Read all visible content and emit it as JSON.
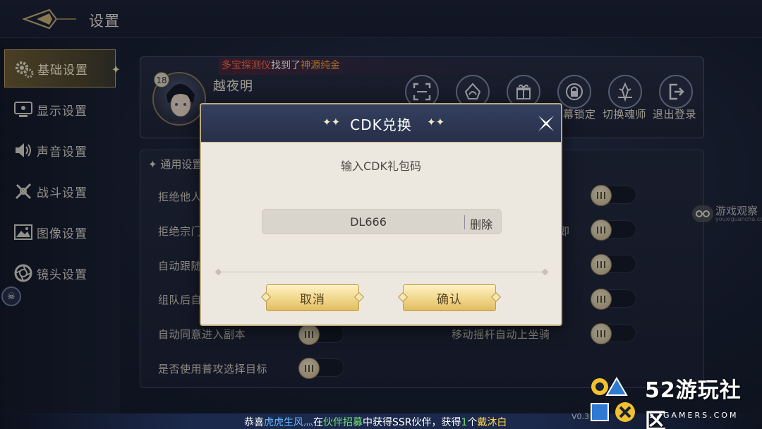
{
  "header": {
    "title": "设置"
  },
  "sidebar": {
    "items": [
      {
        "label": "基础设置",
        "icon": "gear-icon"
      },
      {
        "label": "显示设置",
        "icon": "monitor-icon"
      },
      {
        "label": "声音设置",
        "icon": "speaker-icon"
      },
      {
        "label": "战斗设置",
        "icon": "sword-icon"
      },
      {
        "label": "图像设置",
        "icon": "image-icon"
      },
      {
        "label": "镜头设置",
        "icon": "lens-icon"
      }
    ],
    "active_index": 0
  },
  "ticker": {
    "part1": "多宝探测仪",
    "part2": "找到了",
    "part3": "神源纯金"
  },
  "profile": {
    "level": "18",
    "name": "越夜明",
    "buttons": [
      {
        "label": "",
        "icon": "scan-icon"
      },
      {
        "label": "",
        "icon": "hood-icon"
      },
      {
        "label": "",
        "icon": "gift-icon"
      },
      {
        "label": "幕锁定",
        "icon": "lock-icon"
      },
      {
        "label": "切换魂师",
        "icon": "crystal-icon"
      },
      {
        "label": "退出登录",
        "icon": "logout-icon"
      }
    ]
  },
  "settings": {
    "section_title": "通用设置",
    "left_rows": [
      "拒绝他人",
      "拒绝宗门",
      "自动跟随",
      "组队后自",
      "自动同意进入副本",
      "是否使用普攻选择目标"
    ],
    "right_rows": [
      "",
      "即",
      "",
      "",
      "移动摇杆自动上坐骑"
    ]
  },
  "dialog": {
    "title": "CDK兑换",
    "prompt": "输入CDK礼包码",
    "cdk_value": "DL666",
    "delete_label": "删除",
    "cancel_label": "取消",
    "confirm_label": "确认"
  },
  "bottom_ticker": {
    "p1": "恭喜",
    "p2": "虎虎生风灬",
    "p3": "在",
    "p4": "伙伴招募",
    "p5": "中获得SSR伙伴，获得",
    "p6": "1",
    "p7": "个",
    "p8": "戴沐白"
  },
  "version": "V0.3",
  "watermark_right": {
    "text": "游戏观察",
    "sub": "youxiguancha.com"
  },
  "brand": {
    "name": "52游玩社区",
    "sub": "52GAMERS.COM"
  },
  "colors": {
    "accent_gold": "#e1bd61",
    "ticker_red": "#ff6b4a",
    "ticker_orange": "#ffa23a",
    "name_blue": "#63b6ff",
    "highlight_green": "#6fe46f",
    "highlight_yellow": "#ffd24a"
  }
}
